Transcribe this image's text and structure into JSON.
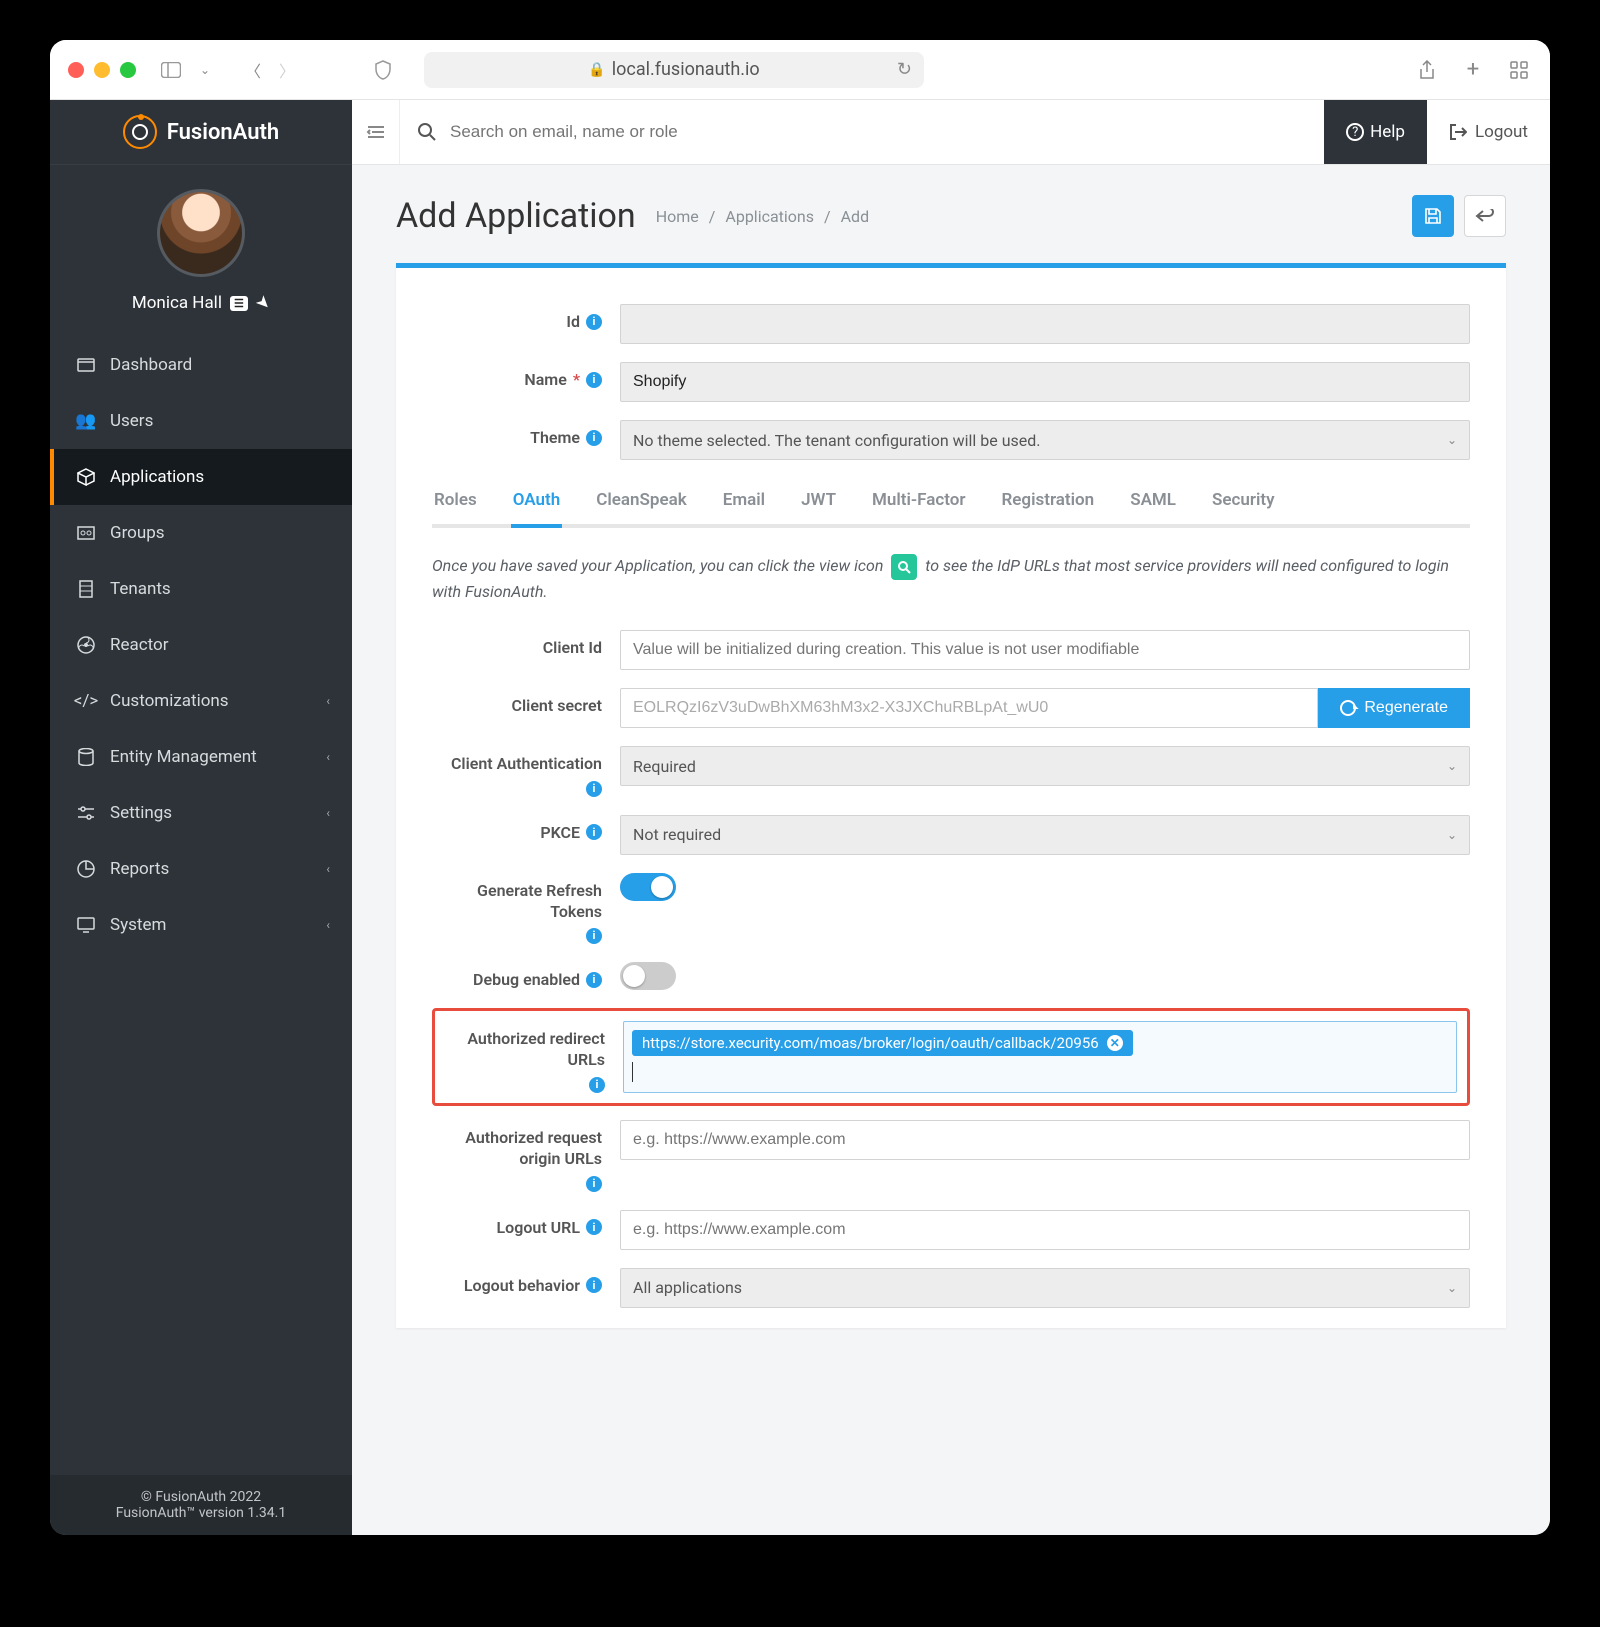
{
  "browser": {
    "url_host": "local.fusionauth.io"
  },
  "header": {
    "search_placeholder": "Search on email, name or role",
    "help_label": "Help",
    "logout_label": "Logout"
  },
  "brand": {
    "name": "FusionAuth"
  },
  "user": {
    "name": "Monica Hall"
  },
  "sidebar": {
    "items": [
      {
        "label": "Dashboard"
      },
      {
        "label": "Users"
      },
      {
        "label": "Applications"
      },
      {
        "label": "Groups"
      },
      {
        "label": "Tenants"
      },
      {
        "label": "Reactor"
      },
      {
        "label": "Customizations",
        "expandable": true
      },
      {
        "label": "Entity Management",
        "expandable": true
      },
      {
        "label": "Settings",
        "expandable": true
      },
      {
        "label": "Reports",
        "expandable": true
      },
      {
        "label": "System",
        "expandable": true
      }
    ],
    "footer_line1": "© FusionAuth 2022",
    "footer_line2": "FusionAuth™ version 1.34.1"
  },
  "page": {
    "title": "Add Application",
    "crumbs": [
      "Home",
      "Applications",
      "Add"
    ]
  },
  "form": {
    "id_label": "Id",
    "name_label": "Name",
    "name_value": "Shopify",
    "theme_label": "Theme",
    "theme_value": "No theme selected. The tenant configuration will be used."
  },
  "tabs": [
    "Roles",
    "OAuth",
    "CleanSpeak",
    "Email",
    "JWT",
    "Multi-Factor",
    "Registration",
    "SAML",
    "Security"
  ],
  "active_tab": "OAuth",
  "oauth": {
    "hint_before": "Once you have saved your Application, you can click the view icon",
    "hint_after": "to see the IdP URLs that most service providers will need configured to login with FusionAuth.",
    "client_id_label": "Client Id",
    "client_id_placeholder": "Value will be initialized during creation. This value is not user modifiable",
    "client_secret_label": "Client secret",
    "client_secret_value": "EOLRQzI6zV3uDwBhXM63hM3x2-X3JXChuRBLpAt_wU0",
    "regenerate_label": "Regenerate",
    "client_auth_label": "Client Authentication",
    "client_auth_value": "Required",
    "pkce_label": "PKCE",
    "pkce_value": "Not required",
    "refresh_label": "Generate Refresh Tokens",
    "debug_label": "Debug enabled",
    "redirect_label": "Authorized redirect URLs",
    "redirect_chip": "https://store.xecurity.com/moas/broker/login/oauth/callback/20956",
    "origin_label": "Authorized request origin URLs",
    "origin_placeholder": "e.g. https://www.example.com",
    "logout_url_label": "Logout URL",
    "logout_url_placeholder": "e.g. https://www.example.com",
    "logout_behavior_label": "Logout behavior",
    "logout_behavior_value": "All applications"
  }
}
